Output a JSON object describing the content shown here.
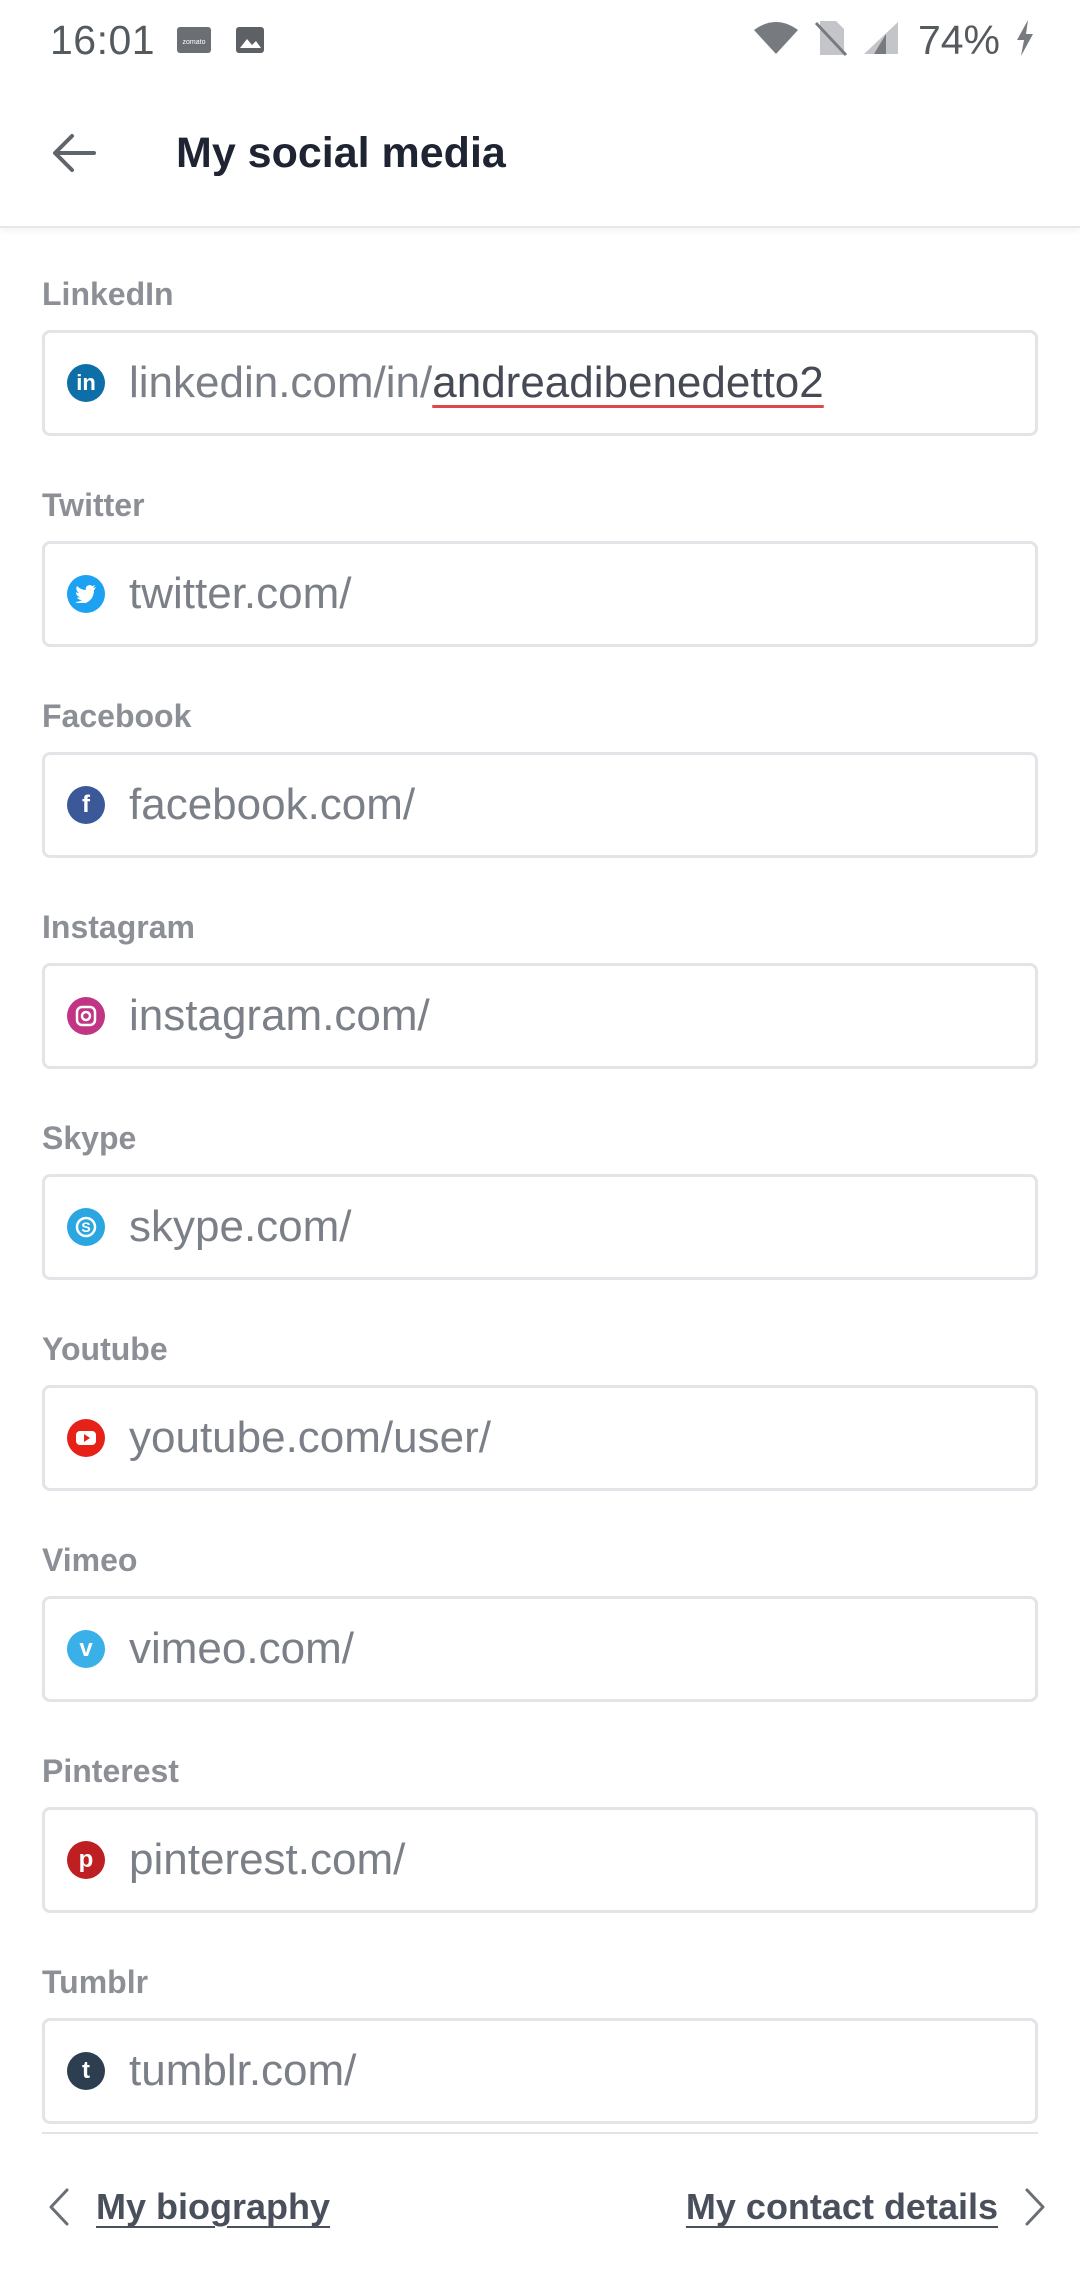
{
  "status_bar": {
    "time": "16:01",
    "notification_icons": [
      "zomato-app-icon",
      "image-icon"
    ],
    "battery": "74%"
  },
  "header": {
    "title": "My social media"
  },
  "fields": [
    {
      "label": "LinkedIn",
      "prefix": "linkedin.com/in/",
      "value": "andreadibenedetto2",
      "icon": "linkedin-icon",
      "color": "#0e6fa8"
    },
    {
      "label": "Twitter",
      "prefix": "twitter.com/",
      "value": "",
      "icon": "twitter-icon",
      "color": "#1da1f2"
    },
    {
      "label": "Facebook",
      "prefix": "facebook.com/",
      "value": "",
      "icon": "facebook-icon",
      "color": "#3b5998"
    },
    {
      "label": "Instagram",
      "prefix": "instagram.com/",
      "value": "",
      "icon": "instagram-icon",
      "color": "#c13584"
    },
    {
      "label": "Skype",
      "prefix": "skype.com/",
      "value": "",
      "icon": "skype-icon",
      "color": "#2aa6e0"
    },
    {
      "label": "Youtube",
      "prefix": "youtube.com/user/",
      "value": "",
      "icon": "youtube-icon",
      "color": "#e62117"
    },
    {
      "label": "Vimeo",
      "prefix": "vimeo.com/",
      "value": "",
      "icon": "vimeo-icon",
      "color": "#39b0e8"
    },
    {
      "label": "Pinterest",
      "prefix": "pinterest.com/",
      "value": "",
      "icon": "pinterest-icon",
      "color": "#bd1f23"
    },
    {
      "label": "Tumblr",
      "prefix": "tumblr.com/",
      "value": "",
      "icon": "tumblr-icon",
      "color": "#2c3e50"
    }
  ],
  "bottom_nav": {
    "prev_label": "My biography",
    "next_label": "My contact details"
  }
}
